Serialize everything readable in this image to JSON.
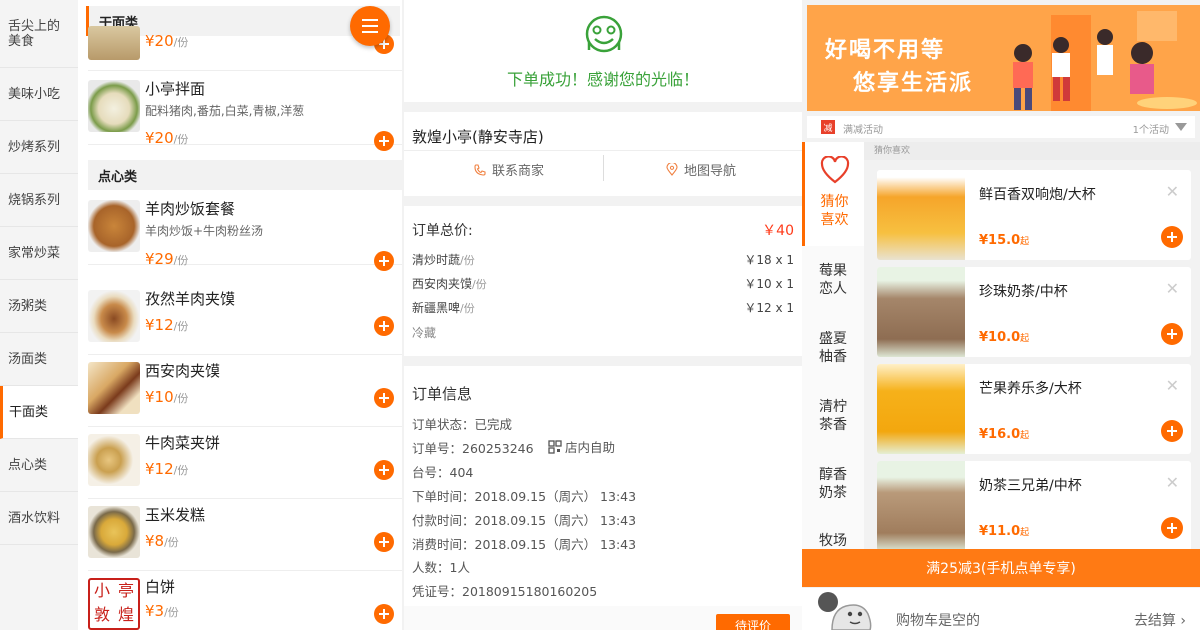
{
  "menu": {
    "categories": [
      "舌尖上的美食",
      "美味小吃",
      "炒烤系列",
      "烧锅系列",
      "家常炒菜",
      "汤粥类",
      "汤面类",
      "干面类",
      "点心类",
      "酒水饮料"
    ],
    "section_noodles": "干面类",
    "section_dimsum": "点心类",
    "dishes": [
      {
        "name": "",
        "desc": "",
        "price": "¥20",
        "unit": "/份"
      },
      {
        "name": "小亭拌面",
        "desc": "配料猪肉,番茄,白菜,青椒,洋葱",
        "price": "¥20",
        "unit": "/份"
      },
      {
        "name": "羊肉炒饭套餐",
        "desc": "羊肉炒饭+牛肉粉丝汤",
        "price": "¥29",
        "unit": "/份"
      },
      {
        "name": "孜然羊肉夹馍",
        "desc": "",
        "price": "¥12",
        "unit": "/份"
      },
      {
        "name": "西安肉夹馍",
        "desc": "",
        "price": "¥10",
        "unit": "/份"
      },
      {
        "name": "牛肉菜夹饼",
        "desc": "",
        "price": "¥12",
        "unit": "/份"
      },
      {
        "name": "玉米发糕",
        "desc": "",
        "price": "¥8",
        "unit": "/份"
      },
      {
        "name": "白饼",
        "desc": "",
        "price": "¥3",
        "unit": "/份"
      }
    ],
    "stamp_text": [
      "小",
      "亭",
      "敦",
      "煌"
    ]
  },
  "order": {
    "success": "下单成功！感谢您的光临！",
    "store": "敦煌小亭(静安寺店)",
    "contact": "联系商家",
    "navigate": "地图导航",
    "total_label": "订单总价:",
    "total_value": "￥40",
    "items": [
      {
        "name": "清炒时蔬",
        "unit": "/份",
        "price": "￥18 x 1"
      },
      {
        "name": "西安肉夹馍",
        "unit": "/份",
        "price": "￥10 x 1"
      },
      {
        "name": "新疆黑啤",
        "unit": "/份",
        "price": "￥12 x 1"
      }
    ],
    "note": "冷藏",
    "info_title": "订单信息",
    "status": "订单状态：已完成",
    "order_no": "订单号：260253246",
    "self_service": "店内自助",
    "table_no": "台号：404",
    "order_time": "下单时间：2018.09.15（周六） 13:43",
    "pay_time": "付款时间：2018.09.15（周六） 13:43",
    "consume_time": "消费时间：2018.09.15（周六） 13:43",
    "people": "人数：1人",
    "voucher": "凭证号：20180915180160205",
    "review_button": "待评价"
  },
  "drinks": {
    "banner_line1": "好喝不用等",
    "banner_line2": "悠享生活派",
    "promo_badge": "减",
    "promo_text": "满减活动",
    "promo_count": "1个活动",
    "guess_header": "猜你喜欢",
    "categories": [
      "猜你喜欢",
      "莓果恋人",
      "盛夏柚香",
      "清柠茶香",
      "醇香奶茶",
      "牧场"
    ],
    "cat_lines": [
      [
        "猜你",
        "喜欢"
      ],
      [
        "莓果",
        "恋人"
      ],
      [
        "盛夏",
        "柚香"
      ],
      [
        "清柠",
        "茶香"
      ],
      [
        "醇香",
        "奶茶"
      ],
      [
        "牧场"
      ]
    ],
    "items": [
      {
        "name": "鲜百香双响炮/大杯",
        "price": "¥15.0",
        "suffix": "起",
        "bg": "#f7b12a"
      },
      {
        "name": "珍珠奶茶/中杯",
        "price": "¥10.0",
        "suffix": "起",
        "bg": "#9b7a5c"
      },
      {
        "name": "芒果养乐多/大杯",
        "price": "¥16.0",
        "suffix": "起",
        "bg": "#f5b21a"
      },
      {
        "name": "奶茶三兄弟/中杯",
        "price": "¥11.0",
        "suffix": "起",
        "bg": "#a07d5d"
      }
    ],
    "promo_offer": "满25减3(手机点单专享)",
    "cart_empty": "购物车是空的",
    "checkout": "去结算"
  },
  "colors": {
    "accent": "#ff6a00",
    "success": "#3aa23a",
    "banner": "#ffa449"
  }
}
